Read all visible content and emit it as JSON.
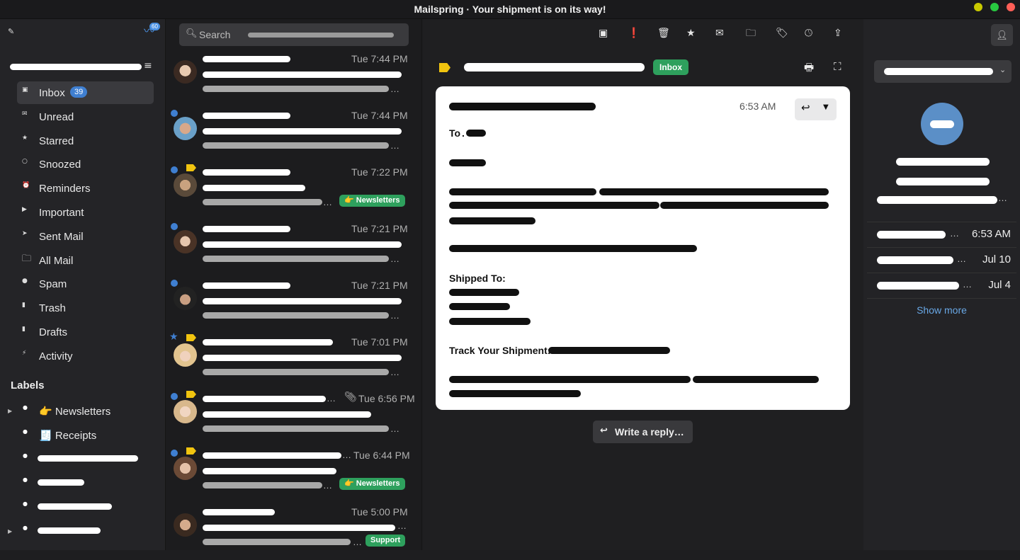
{
  "window": {
    "title": "Mailspring · Your shipment is on its way!"
  },
  "sidebar": {
    "activity_badge": "60",
    "folders": [
      {
        "label": "Inbox",
        "count": "39",
        "icon": "inbox-icon"
      },
      {
        "label": "Unread",
        "icon": "unread-icon"
      },
      {
        "label": "Starred",
        "icon": "star-icon"
      },
      {
        "label": "Snoozed",
        "icon": "snooze-icon"
      },
      {
        "label": "Reminders",
        "icon": "reminder-icon"
      },
      {
        "label": "Important",
        "icon": "important-icon"
      },
      {
        "label": "Sent Mail",
        "icon": "sent-icon"
      },
      {
        "label": "All Mail",
        "icon": "folder-icon"
      },
      {
        "label": "Spam",
        "icon": "spam-icon"
      },
      {
        "label": "Trash",
        "icon": "trash-icon"
      },
      {
        "label": "Drafts",
        "icon": "draft-icon"
      },
      {
        "label": "Activity",
        "icon": "activity-icon"
      }
    ],
    "labels_header": "Labels",
    "labels": [
      {
        "label": "👉 Newsletters"
      },
      {
        "label": "🧾 Receipts"
      }
    ]
  },
  "search": {
    "label": "Search"
  },
  "messages": [
    {
      "time": "Tue 7:44 PM"
    },
    {
      "time": "Tue 7:44 PM"
    },
    {
      "time": "Tue 7:22 PM",
      "label": "👉 Newsletters"
    },
    {
      "time": "Tue 7:21 PM"
    },
    {
      "time": "Tue 7:21 PM"
    },
    {
      "time": "Tue 7:01 PM"
    },
    {
      "time": "Tue 6:56 PM"
    },
    {
      "time": "Tue 6:44 PM",
      "label": "👉 Newsletters"
    },
    {
      "time": "Tue 5:00 PM",
      "label": "Support"
    }
  ],
  "reader": {
    "inbox_tag": "Inbox",
    "time": "6:53 AM",
    "to_label": "To",
    "shipped_to": "Shipped To:",
    "track": "Track Your Shipment:",
    "write_reply": "Write a reply…"
  },
  "right": {
    "rows": [
      {
        "time": "6:53 AM"
      },
      {
        "time": "Jul 10"
      },
      {
        "time": "Jul 4"
      }
    ],
    "show_more": "Show more"
  },
  "colors": {
    "accent": "#3f7fd1",
    "label_green": "#2ea05d",
    "tag_yellow": "#f1c40f"
  }
}
